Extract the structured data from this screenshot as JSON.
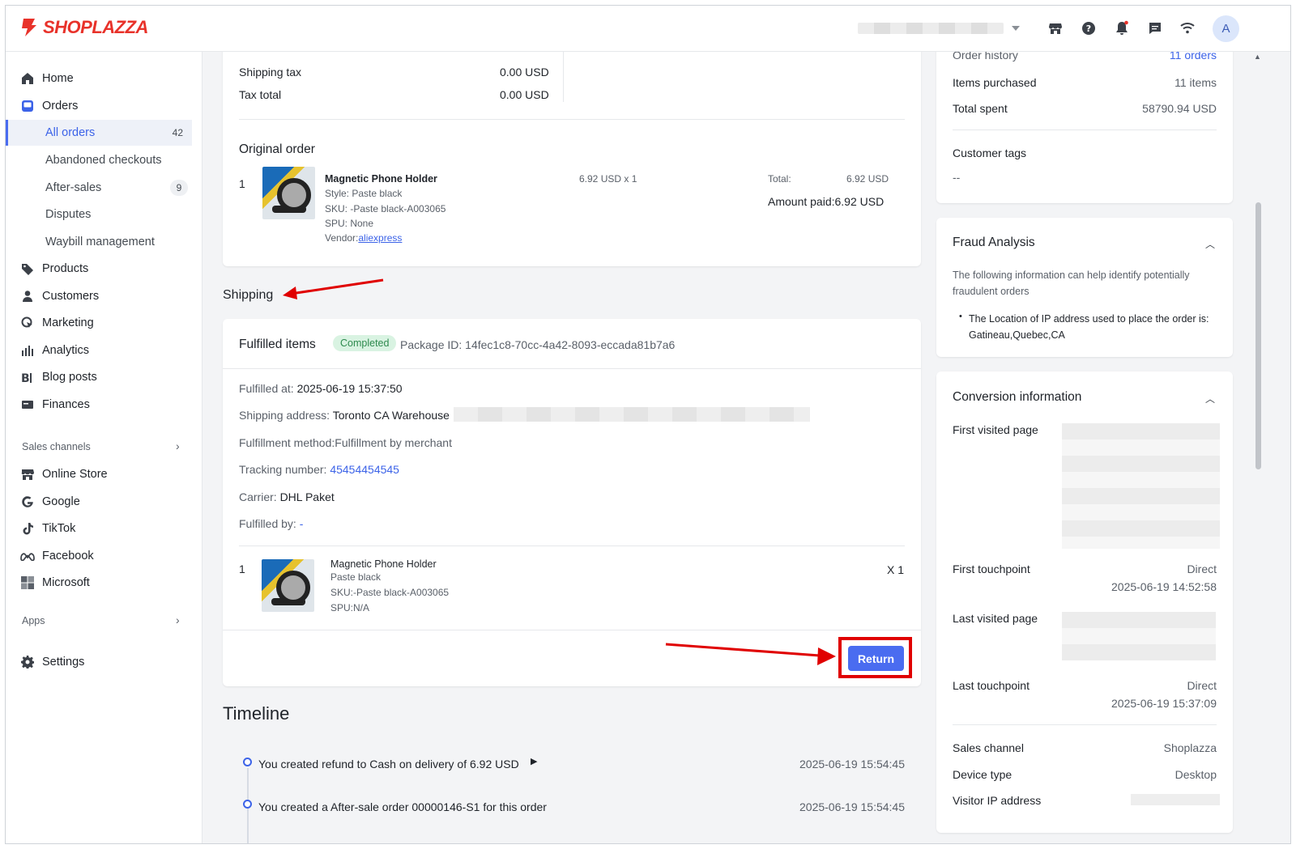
{
  "brand": {
    "name": "SHOPLAZZA",
    "color": "#e8322a"
  },
  "topbar": {
    "icons": [
      "store-icon",
      "help-icon",
      "bell-icon",
      "message-icon",
      "wifi-icon"
    ],
    "avatar_letter": "A"
  },
  "sidebar": {
    "items": [
      {
        "label": "Home",
        "icon": "home-icon"
      },
      {
        "label": "Orders",
        "icon": "orders-icon"
      },
      {
        "label": "All orders",
        "badge": "42",
        "active": true
      },
      {
        "label": "Abandoned checkouts"
      },
      {
        "label": "After-sales",
        "badge": "9"
      },
      {
        "label": "Disputes"
      },
      {
        "label": "Waybill management"
      },
      {
        "label": "Products",
        "icon": "tag-icon"
      },
      {
        "label": "Customers",
        "icon": "person-icon"
      },
      {
        "label": "Marketing",
        "icon": "marketing-icon"
      },
      {
        "label": "Analytics",
        "icon": "analytics-icon"
      },
      {
        "label": "Blog posts",
        "icon": "blog-icon"
      },
      {
        "label": "Finances",
        "icon": "finances-icon"
      }
    ],
    "sales_channels_label": "Sales channels",
    "channels": [
      {
        "label": "Online Store",
        "icon": "store-icon"
      },
      {
        "label": "Google",
        "icon": "google-icon"
      },
      {
        "label": "TikTok",
        "icon": "tiktok-icon"
      },
      {
        "label": "Facebook",
        "icon": "meta-icon"
      },
      {
        "label": "Microsoft",
        "icon": "microsoft-icon"
      }
    ],
    "apps_label": "Apps",
    "settings_label": "Settings"
  },
  "summary": {
    "shipping_tax_label": "Shipping tax",
    "shipping_tax_value": "0.00 USD",
    "tax_total_label": "Tax total",
    "tax_total_value": "0.00 USD"
  },
  "original_order": {
    "title": "Original order",
    "qty_index": "1",
    "product_name": "Magnetic Phone Holder",
    "style": "Style: Paste black",
    "sku": "SKU: -Paste black-A003065",
    "spu": "SPU: None",
    "vendor_label": "Vendor:",
    "vendor": "aliexpress",
    "price": "6.92 USD x 1",
    "total_label": "Total:",
    "total_value": "6.92 USD",
    "amount_paid": "Amount paid:6.92 USD"
  },
  "shipping": {
    "heading": "Shipping",
    "fulfilled_title": "Fulfilled items",
    "status": "Completed",
    "package_id": "Package ID: 14fec1c8-70cc-4a42-8093-eccada81b7a6",
    "fulfilled_at_label": "Fulfilled at:",
    "fulfilled_at": "2025-06-19 15:37:50",
    "address_label": "Shipping address:",
    "address": "Toronto CA Warehouse",
    "method": "Fulfillment method:Fulfillment by merchant",
    "tracking_label": "Tracking number:",
    "tracking": "45454454545",
    "carrier_label": "Carrier:",
    "carrier": "DHL Paket",
    "fulfilled_by_label": "Fulfilled by:",
    "fulfilled_by": "-",
    "item": {
      "index": "1",
      "name": "Magnetic Phone Holder",
      "variant": "Paste black",
      "sku": "SKU:-Paste black-A003065",
      "spu": "SPU:N/A",
      "qty": "X 1"
    },
    "return_label": "Return"
  },
  "timeline": {
    "title": "Timeline",
    "events": [
      {
        "text": "You created refund to Cash on delivery of 6.92 USD",
        "time": "2025-06-19 15:54:45"
      },
      {
        "text": "You created a After-sale order 00000146-S1 for this order",
        "time": "2025-06-19 15:54:45"
      }
    ]
  },
  "customer": {
    "order_history_label": "Order history",
    "order_history_value": "11 orders",
    "items_purchased_label": "Items purchased",
    "items_purchased_value": "11 items",
    "total_spent_label": "Total spent",
    "total_spent_value": "58790.94 USD",
    "tags_label": "Customer tags",
    "tags_value": "--"
  },
  "fraud": {
    "title": "Fraud Analysis",
    "description": "The following information can help identify potentially fraudulent orders",
    "bullet": "The Location of IP address used to place the order is: Gatineau,Quebec,CA"
  },
  "conversion": {
    "title": "Conversion information",
    "first_visited_label": "First visited page",
    "first_touchpoint_label": "First touchpoint",
    "first_touchpoint_value": "Direct",
    "first_touchpoint_time": "2025-06-19 14:52:58",
    "last_visited_label": "Last visited page",
    "last_touchpoint_label": "Last touchpoint",
    "last_touchpoint_value": "Direct",
    "last_touchpoint_time": "2025-06-19 15:37:09",
    "sales_channel_label": "Sales channel",
    "sales_channel_value": "Shoplazza",
    "device_type_label": "Device type",
    "device_type_value": "Desktop",
    "visitor_ip_label": "Visitor IP address"
  },
  "colors": {
    "accent": "#4a6cf0",
    "annotation": "#e00000",
    "success_bg": "#d9f3e2"
  }
}
